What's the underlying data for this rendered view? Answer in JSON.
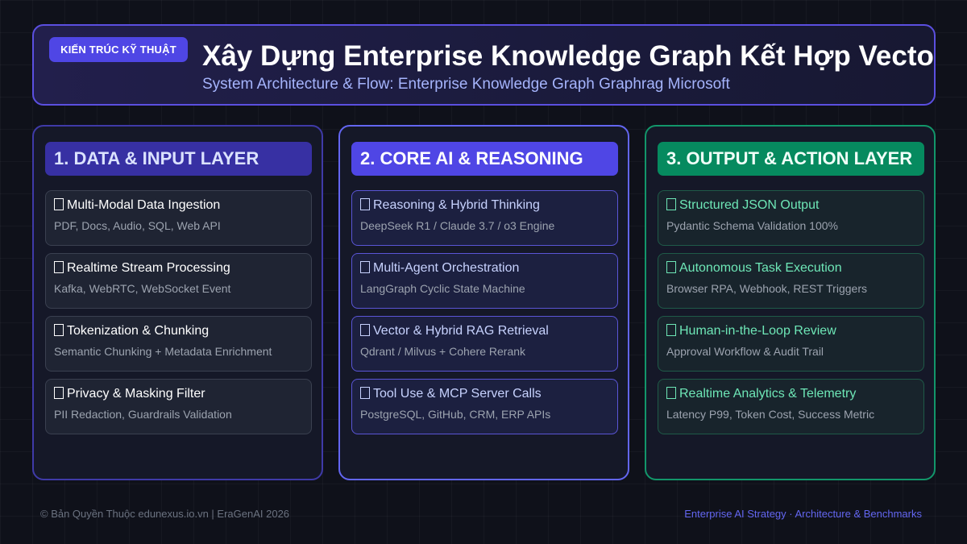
{
  "header": {
    "badge": "KIẾN TRÚC KỸ THUẬT",
    "title": "Xây Dựng Enterprise Knowledge Graph Kết Hợp Vector",
    "subtitle": "System Architecture & Flow: Enterprise Knowledge Graph Graphrag Microsoft"
  },
  "columns": [
    {
      "heading": "1. DATA & INPUT LAYER",
      "cards": [
        {
          "icon": "missing-glyph-icon",
          "title": "Multi-Modal Data Ingestion",
          "desc": "PDF, Docs, Audio, SQL, Web API"
        },
        {
          "icon": "missing-glyph-icon",
          "title": "Realtime Stream Processing",
          "desc": "Kafka, WebRTC, WebSocket Event"
        },
        {
          "icon": "missing-glyph-icon",
          "title": "Tokenization & Chunking",
          "desc": "Semantic Chunking + Metadata Enrichment"
        },
        {
          "icon": "missing-glyph-icon",
          "title": "Privacy & Masking Filter",
          "desc": "PII Redaction, Guardrails Validation"
        }
      ]
    },
    {
      "heading": "2. CORE AI & REASONING",
      "cards": [
        {
          "icon": "missing-glyph-icon",
          "title": "Reasoning & Hybrid Thinking",
          "desc": "DeepSeek R1 / Claude 3.7 / o3 Engine"
        },
        {
          "icon": "missing-glyph-icon",
          "title": "Multi-Agent Orchestration",
          "desc": "LangGraph Cyclic State Machine"
        },
        {
          "icon": "missing-glyph-icon",
          "title": "Vector & Hybrid RAG Retrieval",
          "desc": "Qdrant / Milvus + Cohere Rerank"
        },
        {
          "icon": "missing-glyph-icon",
          "title": "Tool Use & MCP Server Calls",
          "desc": "PostgreSQL, GitHub, CRM, ERP APIs"
        }
      ]
    },
    {
      "heading": "3. OUTPUT & ACTION LAYER",
      "cards": [
        {
          "icon": "missing-glyph-icon",
          "title": "Structured JSON Output",
          "desc": "Pydantic Schema Validation 100%"
        },
        {
          "icon": "missing-glyph-icon",
          "title": "Autonomous Task Execution",
          "desc": "Browser RPA, Webhook, REST Triggers"
        },
        {
          "icon": "missing-glyph-icon",
          "title": "Human-in-the-Loop Review",
          "desc": "Approval Workflow & Audit Trail"
        },
        {
          "icon": "missing-glyph-icon",
          "title": "Realtime Analytics & Telemetry",
          "desc": "Latency P99, Token Cost, Success Metric"
        }
      ]
    }
  ],
  "footer": {
    "left": "© Bản Quyền Thuộc edunexus.io.vn | EraGenAI 2026",
    "right": "Enterprise AI Strategy · Architecture & Benchmarks"
  }
}
